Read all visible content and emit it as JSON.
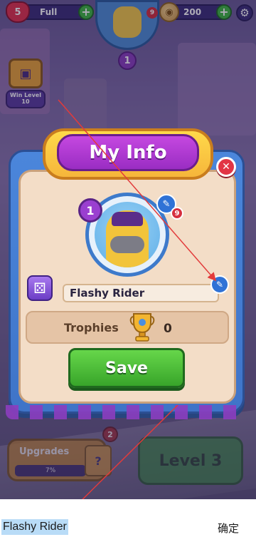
{
  "hud": {
    "lives_count": "5",
    "lives_label": "Full",
    "coins": "200",
    "top_level": "1",
    "top_badge": "9"
  },
  "win_level": {
    "label_line1": "Win Level",
    "label_line2": "10"
  },
  "modal": {
    "title": "My Info",
    "level": "1",
    "avatar_badge": "9",
    "player_name": "Flashy Rider",
    "trophies_label": "Trophies",
    "trophies_value": "0",
    "save_label": "Save"
  },
  "bottom": {
    "upgrades_label": "Upgrades",
    "upgrades_progress": "7%",
    "upgrades_badge": "2",
    "level_button": "Level 3"
  },
  "input_bar": {
    "text": "Flashy Rider",
    "confirm_label": "确定"
  },
  "colors": {
    "accent_blue": "#3f74c8",
    "panel_beige": "#f3ddc7",
    "save_green": "#38a52a",
    "close_red": "#e23545",
    "arrow_red": "#e23b3b"
  }
}
